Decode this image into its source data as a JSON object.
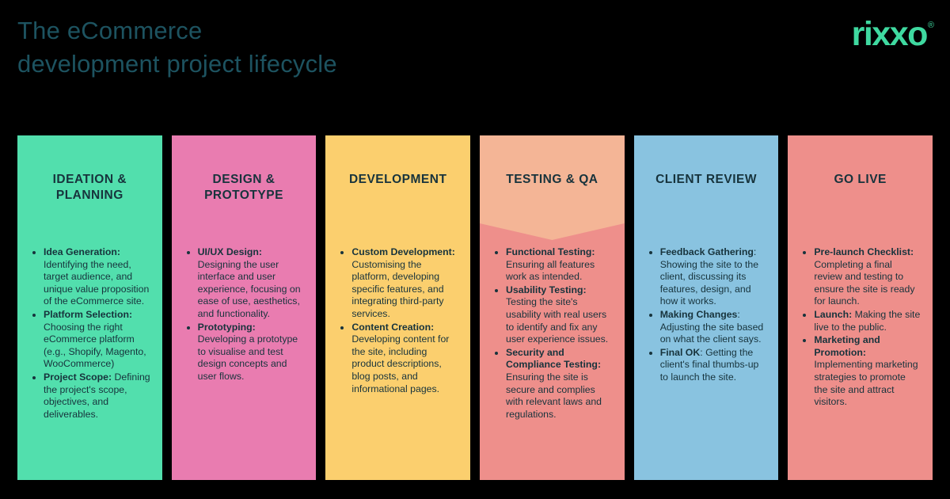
{
  "header": {
    "title": "The eCommerce\ndevelopment project lifecycle",
    "logo_word": "rixxo",
    "logo_registered": "®"
  },
  "theme": {
    "background": "#000000",
    "title_color": "#1D5360",
    "logo_color": "#3FD9A0",
    "text_color": "#17333C"
  },
  "stages": [
    {
      "id": "ideation-planning",
      "title": "IDEATION &\nPLANNING",
      "color": "#52DFAD",
      "accent_color": "#52DFAD",
      "notched": false,
      "bullets": [
        {
          "term": "Idea Generation:",
          "bold_colon": true,
          "desc": " Identifying the need, target audience, and unique value proposition of the eCommerce site."
        },
        {
          "term": "Platform Selection:",
          "bold_colon": true,
          "desc": " Choosing the right eCommerce platform (e.g., Shopify, Magento, WooCommerce)"
        },
        {
          "term": "Project Scope:",
          "bold_colon": true,
          "desc": " Defining the project's scope, objectives, and deliverables."
        }
      ]
    },
    {
      "id": "design-prototype",
      "title": "DESIGN &\nPROTOTYPE",
      "color": "#E97CB0",
      "accent_color": "#E97CB0",
      "notched": false,
      "bullets": [
        {
          "term": "UI/UX Design:",
          "bold_colon": true,
          "desc": " Designing the user interface and user experience, focusing on ease of use, aesthetics, and functionality."
        },
        {
          "term": "Prototyping:",
          "bold_colon": true,
          "desc": " Developing a prototype to visualise and test design concepts and user flows."
        }
      ]
    },
    {
      "id": "development",
      "title": "DEVELOPMENT",
      "color": "#FBCF6E",
      "accent_color": "#FBCF6E",
      "notched": false,
      "bullets": [
        {
          "term": "Custom Development:",
          "bold_colon": true,
          "desc": " Customising the platform, developing specific features, and integrating third-party services."
        },
        {
          "term": "Content Creation:",
          "bold_colon": true,
          "desc": " Developing content for the site, including product descriptions, blog posts, and informational pages."
        }
      ]
    },
    {
      "id": "testing-qa",
      "title": "TESTING & QA",
      "color": "#EE8F8B",
      "accent_color": "#F4B596",
      "notched": true,
      "bullets": [
        {
          "term": "Functional Testing:",
          "bold_colon": true,
          "desc": " Ensuring all features work as intended."
        },
        {
          "term": "Usability Testing:",
          "bold_colon": true,
          "desc": " Testing the site's usability with real users to identify and fix any user experience issues."
        },
        {
          "term": "Security and Compliance Testing:",
          "bold_colon": true,
          "desc": " Ensuring the site is secure and complies with relevant laws and regulations."
        }
      ]
    },
    {
      "id": "client-review",
      "title": "CLIENT REVIEW",
      "color": "#89C3E0",
      "accent_color": "#89C3E0",
      "notched": false,
      "bullets": [
        {
          "term": "Feedback Gathering",
          "bold_colon": false,
          "desc": ": Showing the site to the client, discussing its features, design, and how it works."
        },
        {
          "term": "Making Changes",
          "bold_colon": false,
          "desc": ": Adjusting the site based on what the client says."
        },
        {
          "term": "Final OK",
          "bold_colon": false,
          "desc": ": Getting the client's final thumbs-up to launch the site."
        }
      ]
    },
    {
      "id": "go-live",
      "title": "GO LIVE",
      "color": "#EE8F8B",
      "accent_color": "#EE8F8B",
      "notched": false,
      "bullets": [
        {
          "term": "Pre-launch Checklist:",
          "bold_colon": true,
          "desc": " Completing a final review and testing to ensure the site is ready for launch."
        },
        {
          "term": "Launch:",
          "bold_colon": true,
          "desc": " Making the site live to the public."
        },
        {
          "term": "Marketing and Promotion:",
          "bold_colon": true,
          "desc": " Implementing marketing strategies to promote the site and attract visitors."
        }
      ]
    }
  ]
}
